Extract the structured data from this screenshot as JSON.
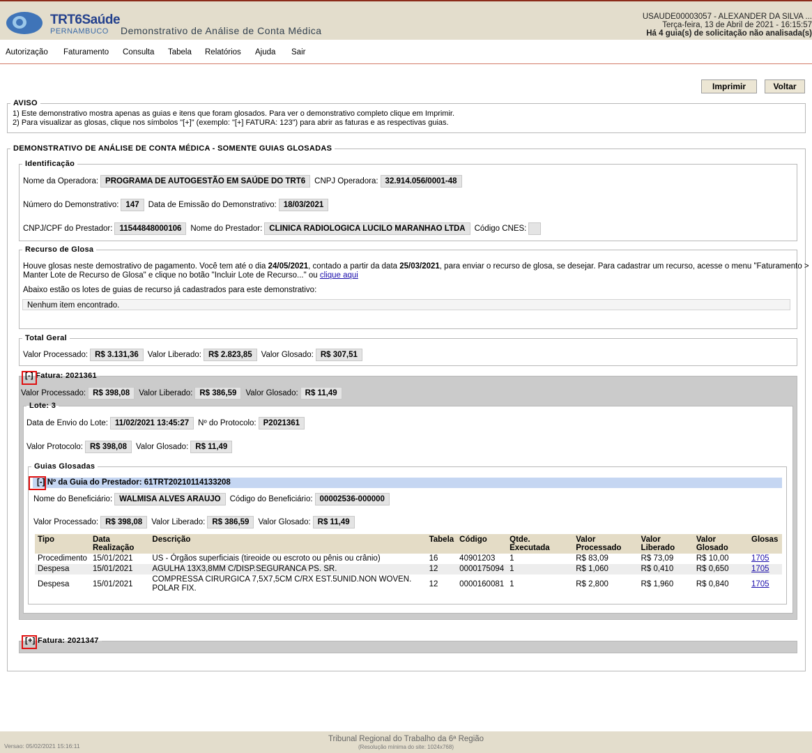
{
  "header": {
    "brand": "TRT6Saúde",
    "brand_sub": "PERNAMBUCO",
    "page_title": "Demonstrativo de Análise de Conta Médica",
    "user": "USAUDE00003057 - ALEXANDER DA SILVA ...",
    "date": "Terça-feira, 13 de Abril de 2021 - 16:15:57",
    "notice": "Há 4 guia(s) de solicitação não analisada(s)"
  },
  "menu": [
    "Autorização",
    "Faturamento",
    "Consulta",
    "Tabela",
    "Relatórios",
    "Ajuda",
    "Sair"
  ],
  "buttons": {
    "print": "Imprimir",
    "back": "Voltar"
  },
  "aviso": {
    "legend": "AVISO",
    "line1": "1) Este demonstrativo mostra apenas as guias e itens que foram glosados. Para ver o demonstrativo completo clique em Imprimir.",
    "line2": "2) Para visualizar as glosas, clique nos símbolos \"[+]\" (exemplo: \"[+] FATURA: 123\") para abrir as faturas e as respectivas guias."
  },
  "main": {
    "legend": "DEMONSTRATIVO DE ANÁLISE DE CONTA MÉDICA - SOMENTE GUIAS GLOSADAS",
    "identificacao": {
      "legend": "Identificação",
      "operadora_label": "Nome da Operadora:",
      "operadora": "PROGRAMA DE AUTOGESTÃO EM SAÚDE DO TRT6",
      "cnpj_op_label": "CNPJ Operadora:",
      "cnpj_op": "32.914.056/0001-48",
      "num_label": "Número do Demonstrativo:",
      "num": "147",
      "emissao_label": "Data de Emissão do Demonstrativo:",
      "emissao": "18/03/2021",
      "cnpj_prest_label": "CNPJ/CPF do Prestador:",
      "cnpj_prest": "11544848000106",
      "prestador_label": "Nome do Prestador:",
      "prestador": "CLINICA RADIOLOGICA LUCILO MARANHAO LTDA",
      "cnes_label": "Código CNES:",
      "cnes": ""
    },
    "recurso": {
      "legend": "Recurso de Glosa",
      "t1": "Houve glosas neste demostrativo de pagamento. Você tem até o dia ",
      "date1": "24/05/2021",
      "t2": ", contado a partir da data ",
      "date2": "25/03/2021",
      "t3": ", para enviar o recurso de glosa, se desejar. Para cadastrar um recurso, acesse o menu \"Faturamento >",
      "line2": "Manter Lote de Recurso de Glosa\" e clique no botão \"Incluir Lote de Recurso...\" ou ",
      "link": "clique aqui",
      "line3": "Abaixo estão os lotes de guias de recurso já cadastrados para este demonstrativo:",
      "empty": "Nenhum item encontrado."
    },
    "total": {
      "legend": "Total Geral",
      "proc_label": "Valor Processado:",
      "proc": "R$ 3.131,36",
      "lib_label": "Valor Liberado:",
      "lib": "R$ 2.823,85",
      "glos_label": "Valor Glosado:",
      "glos": "R$ 307,51"
    },
    "fatura1": {
      "toggle": "[-]",
      "title": "Fatura: 2021361",
      "proc_label": "Valor Processado:",
      "proc": "R$ 398,08",
      "lib_label": "Valor Liberado:",
      "lib": "R$ 386,59",
      "glos_label": "Valor Glosado:",
      "glos": "R$ 11,49",
      "lote": {
        "legend": "Lote: 3",
        "envio_label": "Data de Envio do Lote:",
        "envio": "11/02/2021 13:45:27",
        "protocolo_label": "Nº do Protocolo:",
        "protocolo": "P2021361",
        "vprot_label": "Valor Protocolo:",
        "vprot": "R$ 398,08",
        "vglos_label": "Valor Glosado:",
        "vglos": "R$ 11,49",
        "guias": {
          "legend": "Guias Glosadas",
          "toggle": "[-]",
          "title": "Nº da Guia do Prestador: 61TRT20210114133208",
          "benef_label": "Nome do Beneficiário:",
          "benef": "WALMISA ALVES ARAUJO",
          "cod_label": "Código do Beneficiário:",
          "cod": "00002536-000000",
          "proc_label": "Valor Processado:",
          "proc": "R$ 398,08",
          "lib_label": "Valor Liberado:",
          "lib": "R$ 386,59",
          "glos_label": "Valor Glosado:",
          "glos": "R$ 11,49",
          "columns": [
            "Tipo",
            "Data Realização",
            "Descrição",
            "Tabela",
            "Código",
            "Qtde. Executada",
            "Valor Processado",
            "Valor Liberado",
            "Valor Glosado",
            "Glosas"
          ],
          "rows": [
            [
              "Procedimento",
              "15/01/2021",
              "US - Órgãos superficiais (tireoide ou escroto ou pênis ou crânio)",
              "16",
              "40901203",
              "1",
              "R$ 83,09",
              "R$ 73,09",
              "R$ 10,00",
              "1705"
            ],
            [
              "Despesa",
              "15/01/2021",
              "AGULHA 13X3,8MM C/DISP.SEGURANCA PS. SR.",
              "12",
              "0000175094",
              "1",
              "R$ 1,060",
              "R$ 0,410",
              "R$ 0,650",
              "1705"
            ],
            [
              "Despesa",
              "15/01/2021",
              "COMPRESSA CIRURGICA 7,5X7,5CM C/RX EST.5UNID.NON WOVEN. POLAR FIX.",
              "12",
              "0000160081",
              "1",
              "R$ 2,800",
              "R$ 1,960",
              "R$ 0,840",
              "1705"
            ]
          ]
        }
      }
    },
    "fatura2": {
      "toggle": "[+]",
      "title": "Fatura: 2021347"
    }
  },
  "footer": {
    "org": "Tribunal Regional do Trabalho da 6ª Região",
    "res": "(Resolução mínima do site: 1024x768)",
    "version": "Versao: 05/02/2021 15:16:11"
  },
  "colors": {
    "accent": "#8b2b1a",
    "header_bg": "#e3ddcc",
    "guia_bar": "#c5d6f2",
    "highlight": "#e01010"
  }
}
